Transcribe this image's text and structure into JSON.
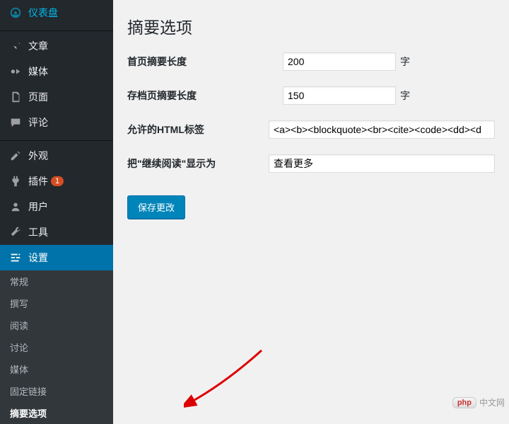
{
  "sidebar": {
    "items": [
      {
        "label": "仪表盘",
        "icon": "dashboard"
      },
      {
        "label": "文章",
        "icon": "pin"
      },
      {
        "label": "媒体",
        "icon": "media"
      },
      {
        "label": "页面",
        "icon": "page"
      },
      {
        "label": "评论",
        "icon": "comment"
      },
      {
        "label": "外观",
        "icon": "appearance"
      },
      {
        "label": "插件",
        "icon": "plugin",
        "badge": "1"
      },
      {
        "label": "用户",
        "icon": "user"
      },
      {
        "label": "工具",
        "icon": "tool"
      },
      {
        "label": "设置",
        "icon": "settings",
        "active": true
      }
    ],
    "sub": [
      {
        "label": "常规"
      },
      {
        "label": "撰写"
      },
      {
        "label": "阅读"
      },
      {
        "label": "讨论"
      },
      {
        "label": "媒体"
      },
      {
        "label": "固定链接"
      },
      {
        "label": "摘要选项",
        "current": true
      }
    ]
  },
  "page": {
    "title": "摘要选项",
    "fields": {
      "home_excerpt_label": "首页摘要长度",
      "home_excerpt_value": "200",
      "suffix_char": "字",
      "archive_excerpt_label": "存档页摘要长度",
      "archive_excerpt_value": "150",
      "allowed_html_label": "允许的HTML标签",
      "allowed_html_value": "<a><b><blockquote><br><cite><code><dd><d",
      "read_more_label": "把\"继续阅读\"显示为",
      "read_more_value": "查看更多"
    },
    "save_button": "保存更改"
  },
  "watermark": {
    "badge": "php",
    "text": "中文网"
  }
}
